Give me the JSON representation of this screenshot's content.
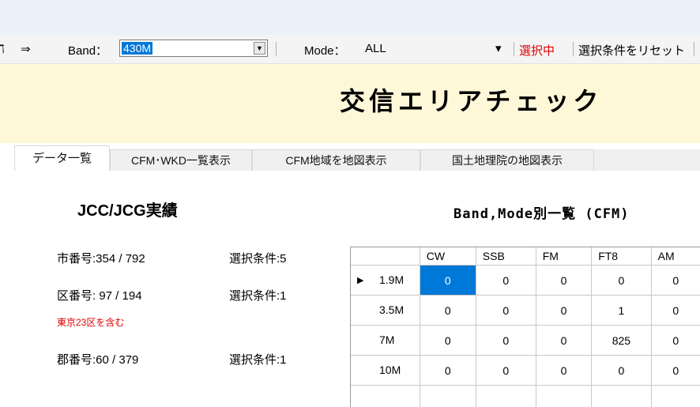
{
  "toolbar": {
    "left_glyph": "ℸ",
    "arrow": "⇒",
    "band_label": "Band：",
    "band_value": "430M",
    "mode_label": "Mode：",
    "mode_value": "ALL",
    "mode_dropdown_glyph": "▾",
    "selecting": "選択中",
    "reset": "選択条件をリセット",
    "selecting_color": "#e00000"
  },
  "banner": {
    "title": "交信エリアチェック",
    "background": "#fff8d8"
  },
  "tabs": [
    "データ一覧",
    "CFM･WKD一覧表示",
    "CFM地域を地図表示",
    "国土地理院の地図表示"
  ],
  "summary": {
    "heading": "JCC/JCG実績",
    "city": {
      "label": "市番号:354 / 792",
      "cond": "選択条件:5"
    },
    "ward": {
      "label": "区番号: 97 / 194",
      "cond": "選択条件:1",
      "note": "東京23区を含む"
    },
    "gun": {
      "label": "郡番号:60 / 379",
      "cond": "選択条件:1"
    }
  },
  "grid": {
    "heading": "Band,Mode別一覧 (CFM)",
    "columns": [
      "CW",
      "SSB",
      "FM",
      "FT8",
      "AM"
    ],
    "rows": [
      {
        "band": "1.9M",
        "cells": [
          "0",
          "0",
          "0",
          "0",
          "0"
        ]
      },
      {
        "band": "3.5M",
        "cells": [
          "0",
          "0",
          "0",
          "1",
          "0"
        ]
      },
      {
        "band": "7M",
        "cells": [
          "0",
          "0",
          "0",
          "825",
          "0"
        ]
      },
      {
        "band": "10M",
        "cells": [
          "0",
          "0",
          "0",
          "0",
          "0"
        ]
      }
    ],
    "current_row_marker": "▶"
  }
}
